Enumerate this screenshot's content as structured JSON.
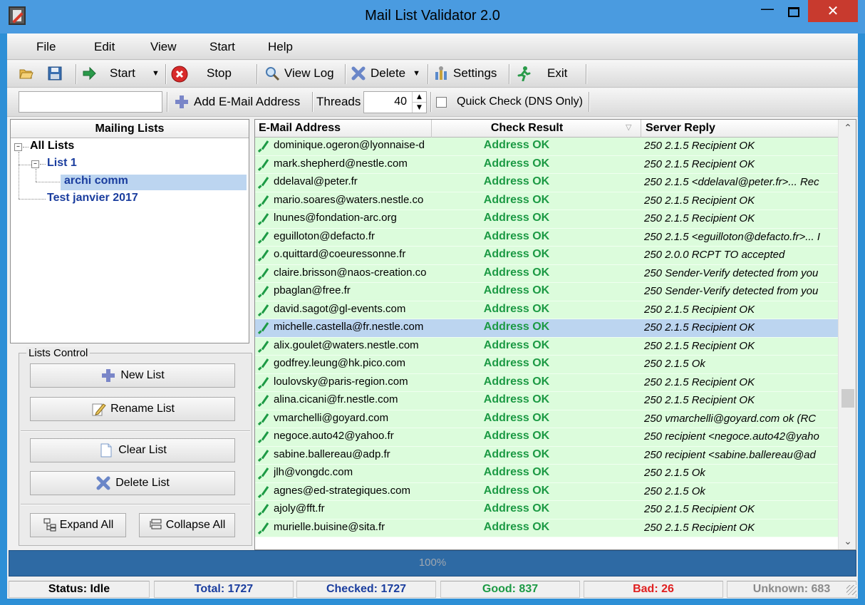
{
  "window": {
    "title": "Mail List Validator 2.0"
  },
  "menu": [
    "File",
    "Edit",
    "View",
    "Start",
    "Help"
  ],
  "toolbar": {
    "start": "Start",
    "stop": "Stop",
    "view_log": "View Log",
    "delete": "Delete",
    "settings": "Settings",
    "exit": "Exit"
  },
  "toolbar2": {
    "email_input_value": "",
    "add_email": "Add E-Mail Address",
    "threads_label": "Threads",
    "threads_value": "40",
    "quick_check": "Quick Check (DNS Only)",
    "quick_check_checked": false
  },
  "mailing_lists": {
    "header": "Mailing Lists",
    "root": "All Lists",
    "list1": "List 1",
    "sub_selected": "archi comm",
    "list2": "Test janvier 2017"
  },
  "lists_control": {
    "label": "Lists Control",
    "new_list": "New List",
    "rename_list": "Rename List",
    "clear_list": "Clear List",
    "delete_list": "Delete List",
    "expand_all": "Expand All",
    "collapse_all": "Collapse All"
  },
  "grid": {
    "columns": [
      "E-Mail Address",
      "Check Result",
      "Server Reply"
    ],
    "selected_row": 10,
    "rows": [
      {
        "email": "dominique.ogeron@lyonnaise-d",
        "result": "Address OK",
        "reply": "250 2.1.5 Recipient OK"
      },
      {
        "email": "mark.shepherd@nestle.com",
        "result": "Address OK",
        "reply": "250 2.1.5 Recipient OK"
      },
      {
        "email": "ddelaval@peter.fr",
        "result": "Address OK",
        "reply": "250 2.1.5 <ddelaval@peter.fr>... Rec"
      },
      {
        "email": "mario.soares@waters.nestle.co",
        "result": "Address OK",
        "reply": "250 2.1.5 Recipient OK"
      },
      {
        "email": "lnunes@fondation-arc.org",
        "result": "Address OK",
        "reply": "250 2.1.5 Recipient OK"
      },
      {
        "email": "eguilloton@defacto.fr",
        "result": "Address OK",
        "reply": "250 2.1.5 <eguilloton@defacto.fr>... I"
      },
      {
        "email": "o.quittard@coeuressonne.fr",
        "result": "Address OK",
        "reply": "250 2.0.0 RCPT TO accepted"
      },
      {
        "email": "claire.brisson@naos-creation.co",
        "result": "Address OK",
        "reply": "250 Sender-Verify detected from you"
      },
      {
        "email": "pbaglan@free.fr",
        "result": "Address OK",
        "reply": "250 Sender-Verify detected from you"
      },
      {
        "email": "david.sagot@gl-events.com",
        "result": "Address OK",
        "reply": "250 2.1.5 Recipient OK"
      },
      {
        "email": "michelle.castella@fr.nestle.com",
        "result": "Address OK",
        "reply": "250 2.1.5 Recipient OK"
      },
      {
        "email": "alix.goulet@waters.nestle.com",
        "result": "Address OK",
        "reply": "250 2.1.5 Recipient OK"
      },
      {
        "email": "godfrey.leung@hk.pico.com",
        "result": "Address OK",
        "reply": "250 2.1.5 Ok"
      },
      {
        "email": "loulovsky@paris-region.com",
        "result": "Address OK",
        "reply": "250 2.1.5 Recipient OK"
      },
      {
        "email": "alina.cicani@fr.nestle.com",
        "result": "Address OK",
        "reply": "250 2.1.5 Recipient OK"
      },
      {
        "email": "vmarchelli@goyard.com",
        "result": "Address OK",
        "reply": "250 vmarchelli@goyard.com ok (RC"
      },
      {
        "email": "negoce.auto42@yahoo.fr",
        "result": "Address OK",
        "reply": "250 recipient <negoce.auto42@yaho"
      },
      {
        "email": "sabine.ballereau@adp.fr",
        "result": "Address OK",
        "reply": "250 recipient <sabine.ballereau@ad"
      },
      {
        "email": "jlh@vongdc.com",
        "result": "Address OK",
        "reply": "250 2.1.5 Ok"
      },
      {
        "email": "agnes@ed-strategiques.com",
        "result": "Address OK",
        "reply": "250 2.1.5 Ok"
      },
      {
        "email": "ajoly@fft.fr",
        "result": "Address OK",
        "reply": "250 2.1.5 Recipient OK"
      },
      {
        "email": "murielle.buisine@sita.fr",
        "result": "Address OK",
        "reply": "250 2.1.5 Recipient OK"
      }
    ]
  },
  "progress": {
    "text": "100%",
    "fraction": 1.0
  },
  "status": {
    "status": "Status: Idle",
    "total": "Total: 1727",
    "checked": "Checked: 1727",
    "good": "Good: 837",
    "bad": "Bad: 26",
    "unknown": "Unknown: 683"
  },
  "colors": {
    "row_ok": "#dcfcdc",
    "row_selected": "#bcd5f0",
    "ok_text": "#1c9a44",
    "total_text": "#1a3d9e",
    "good_text": "#1c9a44",
    "bad_text": "#e02020",
    "unknown_text": "#8a8a8a",
    "progress": "#2e6aa4"
  }
}
